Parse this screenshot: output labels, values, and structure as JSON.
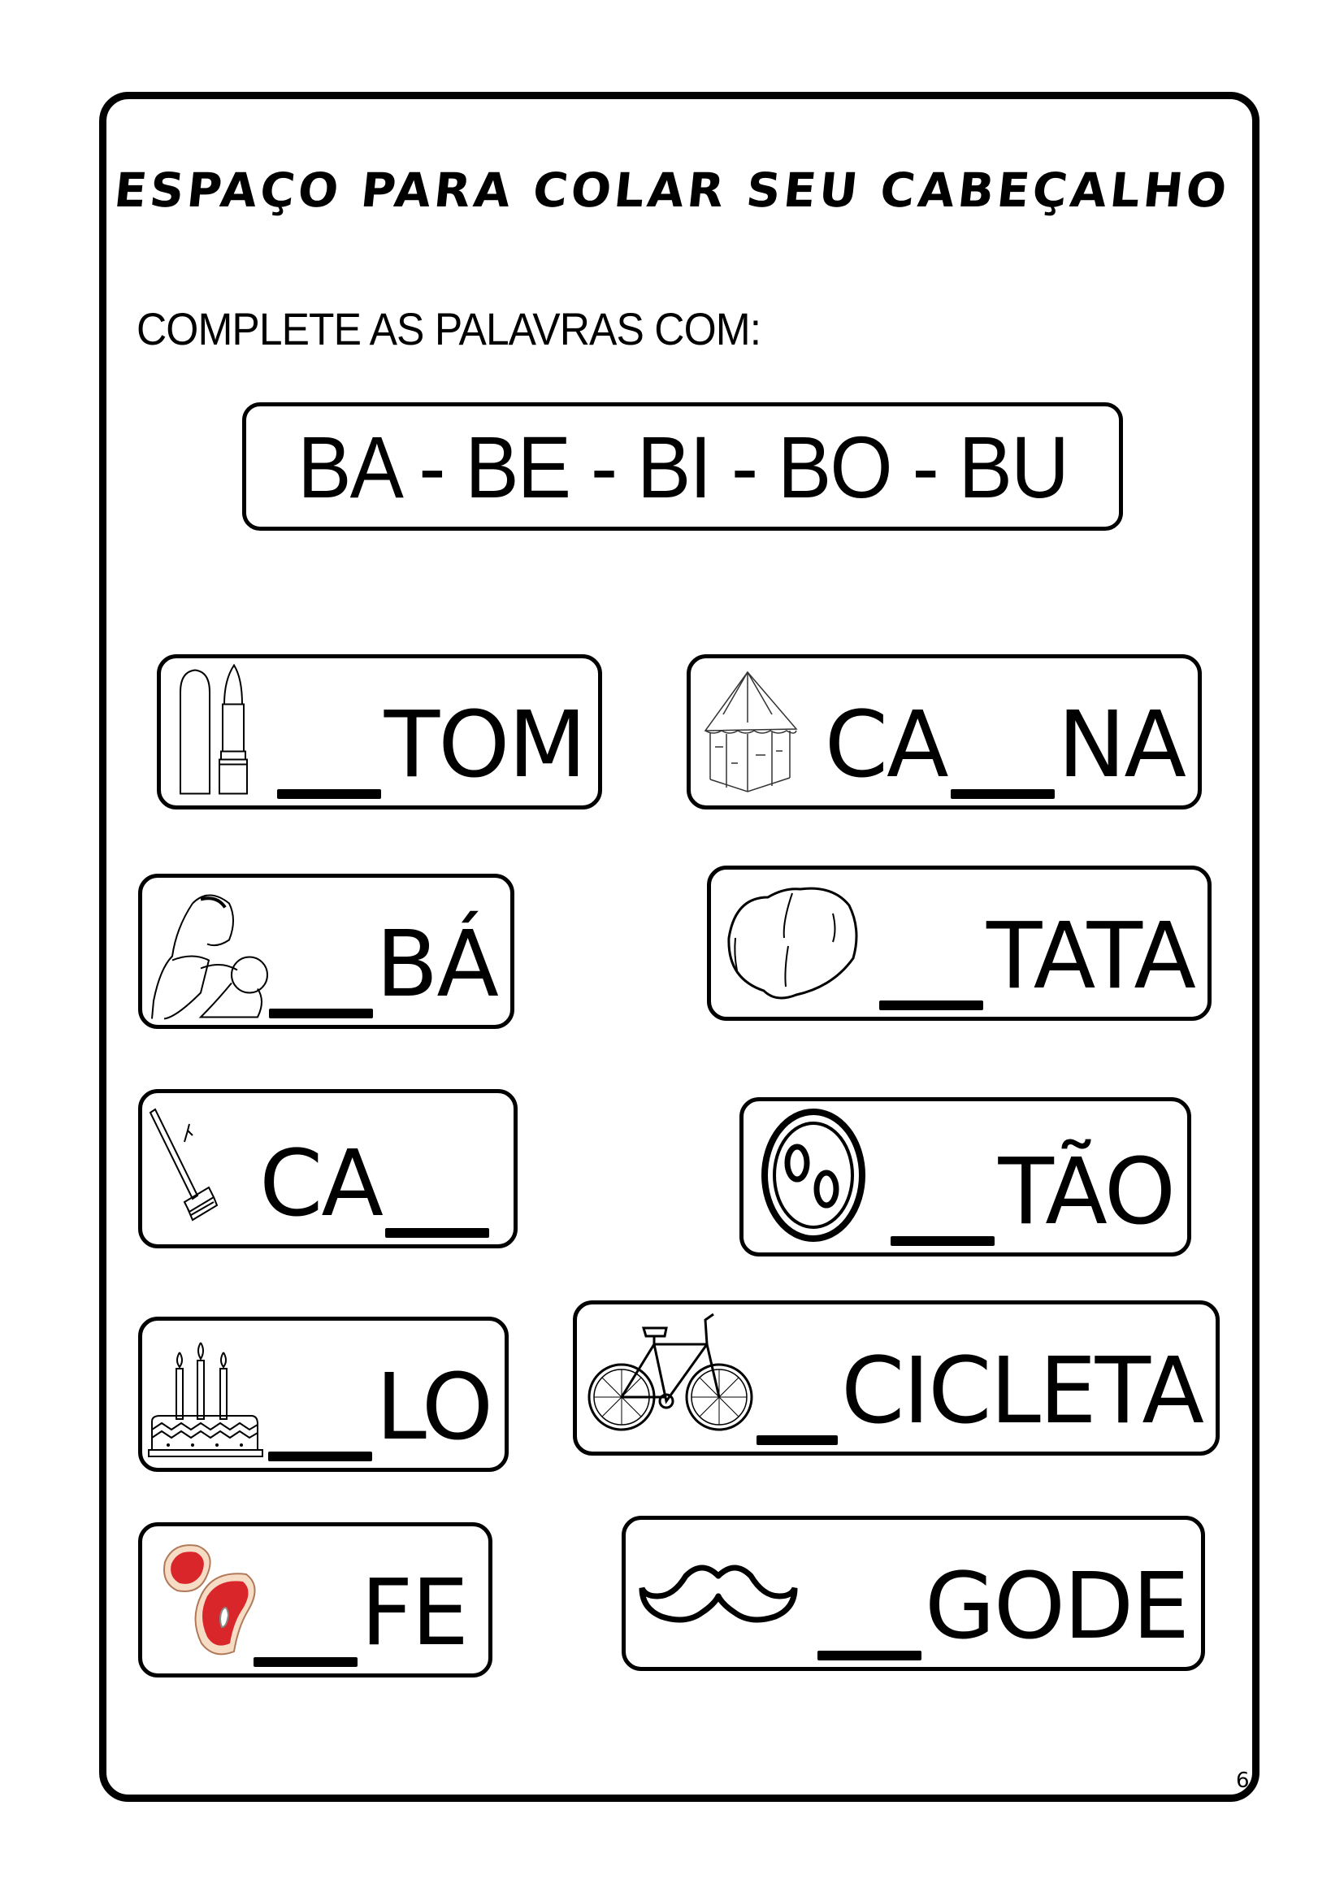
{
  "header": {
    "title": "ESPAÇO PARA COLAR SEU CABEÇALHO"
  },
  "instruction": "COMPLETE AS PALAVRAS COM:",
  "syllables": "BA - BE - BI - BO - BU",
  "cards": [
    {
      "picture": "lipstick-icon",
      "before": "",
      "after": "TOM"
    },
    {
      "picture": "hut-icon",
      "before": "CA",
      "after": "NA"
    },
    {
      "picture": "mother-baby-icon",
      "before": "",
      "after": "BÁ"
    },
    {
      "picture": "potato-icon",
      "before": "",
      "after": "TATA"
    },
    {
      "picture": "broom-icon",
      "before": "CA",
      "after": ""
    },
    {
      "picture": "button-icon",
      "before": "",
      "after": "TÃO"
    },
    {
      "picture": "cake-icon",
      "before": "",
      "after": "LO"
    },
    {
      "picture": "bicycle-icon",
      "before": "",
      "after": "CICLETA"
    },
    {
      "picture": "steak-icon",
      "before": "",
      "after": "FE"
    },
    {
      "picture": "mustache-icon",
      "before": "",
      "after": "GODE"
    }
  ],
  "colors": {
    "ink": "#000000",
    "paper": "#ffffff",
    "steak_red": "#d9262b",
    "steak_fat": "#f6dcc4"
  },
  "page_number": "6"
}
